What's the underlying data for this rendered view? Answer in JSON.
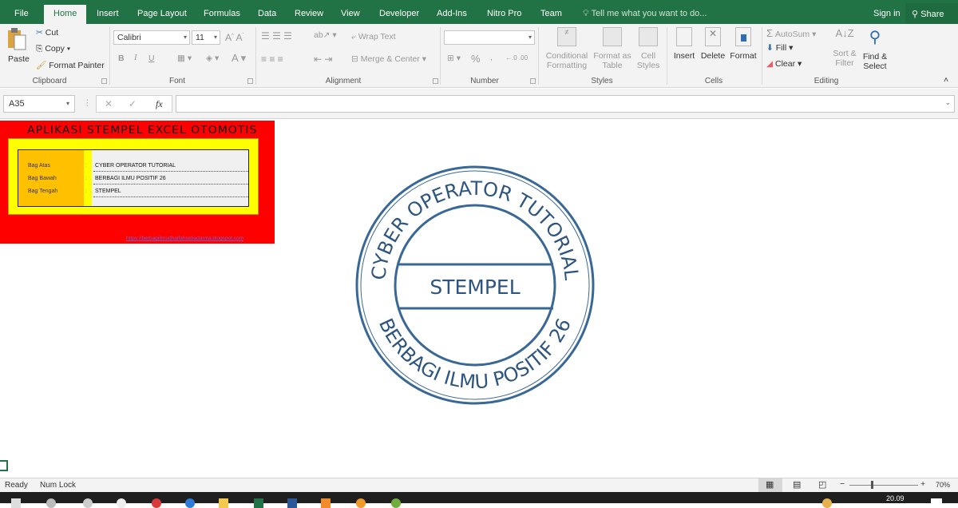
{
  "tabs": [
    {
      "label": "File"
    },
    {
      "label": "Home",
      "active": true
    },
    {
      "label": "Insert"
    },
    {
      "label": "Page Layout"
    },
    {
      "label": "Formulas"
    },
    {
      "label": "Data"
    },
    {
      "label": "Review"
    },
    {
      "label": "View"
    },
    {
      "label": "Developer"
    },
    {
      "label": "Add-Ins"
    },
    {
      "label": "Nitro Pro"
    },
    {
      "label": "Team"
    }
  ],
  "tell_me": "Tell me what you want to do...",
  "sign_in": "Sign in",
  "share": "Share",
  "ribbon": {
    "clipboard": {
      "paste": "Paste",
      "cut": "Cut",
      "copy": "Copy",
      "format_painter": "Format Painter",
      "label": "Clipboard"
    },
    "font": {
      "name": "Calibri",
      "size": "11",
      "bold": "B",
      "italic": "I",
      "underline": "U",
      "label": "Font"
    },
    "alignment": {
      "wrap_text": "Wrap Text",
      "merge_center": "Merge & Center",
      "label": "Alignment"
    },
    "number": {
      "format": "",
      "percent": "%",
      "comma": ",",
      "label": "Number"
    },
    "styles": {
      "conditional": "Conditional",
      "conditional2": "Formatting",
      "format_as": "Format as",
      "format_as2": "Table",
      "cell": "Cell",
      "cell2": "Styles",
      "label": "Styles"
    },
    "cells": {
      "insert": "Insert",
      "delete": "Delete",
      "format": "Format",
      "label": "Cells"
    },
    "editing": {
      "autosum": "AutoSum",
      "fill": "Fill",
      "clear": "Clear",
      "sort": "Sort &",
      "sort2": "Filter",
      "find": "Find &",
      "find2": "Select",
      "label": "Editing"
    }
  },
  "formula_bar": {
    "name_box": "A35",
    "cancel": "✕",
    "enter": "✓",
    "fx": "fx",
    "value": ""
  },
  "sheet": {
    "title": "APLIKASI STEMPEL EXCEL OTOMOTIS",
    "rows": [
      {
        "label": "Bag Atas",
        "colon": ":",
        "value": "CYBER OPERATOR TUTORIAL"
      },
      {
        "label": "Bag Bawah",
        "colon": ":",
        "value": "BERBAGI ILMU POSITIF 26"
      },
      {
        "label": "Bag Tengah",
        "colon": ":",
        "value": "STEMPEL"
      }
    ],
    "url": "https://berbagiilmudhalfahsetiadarma.blogspot.com",
    "stamp": {
      "top_text": "CYBER OPERATOR TUTORIAL",
      "bottom_text": "BERBAGI ILMU POSITIF 26",
      "center_text": "STEMPEL",
      "color": "#3a6896"
    }
  },
  "status": {
    "ready": "Ready",
    "num_lock": "Num Lock",
    "zoom": "70%"
  },
  "taskbar": {
    "time": "20.09"
  },
  "colors": {
    "excel_green": "#217346",
    "red_panel": "#ff0000",
    "yellow": "#ffff00",
    "orange": "#ffc000"
  }
}
